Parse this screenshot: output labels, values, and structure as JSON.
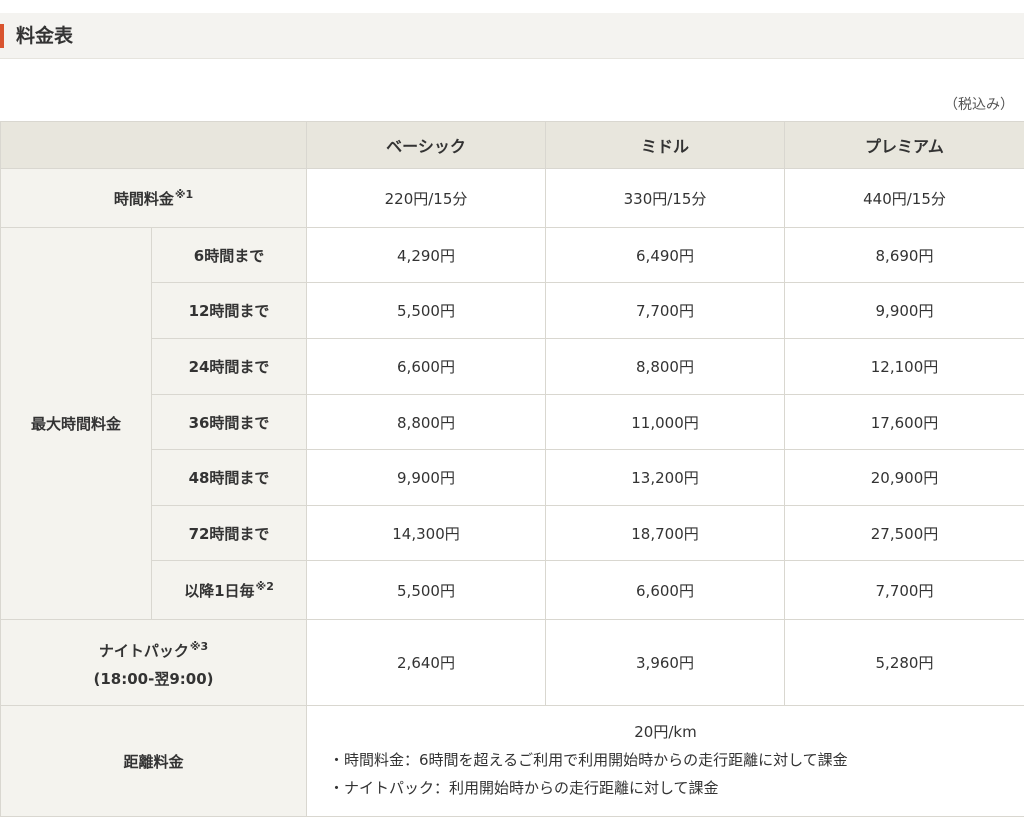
{
  "heading": {
    "title": "料金表"
  },
  "tax_note": "（税込み）",
  "table": {
    "columns": [
      "ベーシック",
      "ミドル",
      "プレミアム"
    ],
    "hourly": {
      "label": "時間料金",
      "note_mark": "※1",
      "values": [
        "220円/15分",
        "330円/15分",
        "440円/15分"
      ]
    },
    "max": {
      "label": "最大時間料金",
      "rows": [
        {
          "label": "6時間まで",
          "note_mark": "",
          "values": [
            "4,290円",
            "6,490円",
            "8,690円"
          ]
        },
        {
          "label": "12時間まで",
          "note_mark": "",
          "values": [
            "5,500円",
            "7,700円",
            "9,900円"
          ]
        },
        {
          "label": "24時間まで",
          "note_mark": "",
          "values": [
            "6,600円",
            "8,800円",
            "12,100円"
          ]
        },
        {
          "label": "36時間まで",
          "note_mark": "",
          "values": [
            "8,800円",
            "11,000円",
            "17,600円"
          ]
        },
        {
          "label": "48時間まで",
          "note_mark": "",
          "values": [
            "9,900円",
            "13,200円",
            "20,900円"
          ]
        },
        {
          "label": "72時間まで",
          "note_mark": "",
          "values": [
            "14,300円",
            "18,700円",
            "27,500円"
          ]
        },
        {
          "label": "以降1日毎",
          "note_mark": "※2",
          "values": [
            "5,500円",
            "6,600円",
            "7,700円"
          ]
        }
      ]
    },
    "night": {
      "label": "ナイトパック",
      "note_mark": "※3",
      "sub": "(18:00-翌9:00)",
      "values": [
        "2,640円",
        "3,960円",
        "5,280円"
      ]
    },
    "distance": {
      "label": "距離料金",
      "value": "20円/km",
      "notes": [
        "・時間料金：6時間を超えるご利用で利用開始時からの走行距離に対して課金",
        "・ナイトパック：利用開始時からの走行距離に対して課金"
      ]
    }
  }
}
